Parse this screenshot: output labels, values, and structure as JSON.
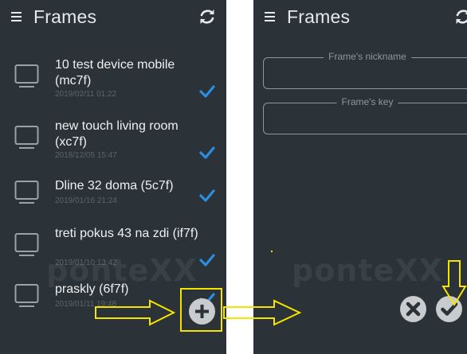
{
  "app": {
    "title": "Frames",
    "icons": {
      "menu": "menu-icon",
      "refresh": "refresh-icon"
    }
  },
  "frames_list": [
    {
      "name": "10 test device mobile (mc7f)",
      "date": "2019/02/11 01:22",
      "checked": true,
      "icon": "tv-icon"
    },
    {
      "name": "new touch living room (xc7f)",
      "date": "2018/12/05 15:47",
      "checked": true,
      "icon": "tv-icon"
    },
    {
      "name": "Dline 32 doma (5c7f)",
      "date": "2019/01/16 21:24",
      "checked": true,
      "icon": "tv-icon"
    },
    {
      "name": "treti pokus 43 na zdi (if7f)",
      "date": "2019/01/10 13:42",
      "checked": true,
      "icon": "tv-icon"
    },
    {
      "name": "praskly (6f7f)",
      "date": "2019/01/11 19:48",
      "checked": true,
      "icon": "tv-icon"
    }
  ],
  "add_frame_form": {
    "nickname_label": "Frame's nickname",
    "nickname_value": "",
    "key_label": "Frame's key",
    "key_value": ""
  },
  "buttons": {
    "add": "plus-icon",
    "cancel": "close-icon",
    "confirm": "check-icon"
  },
  "watermark_text": "ponteXX",
  "colors": {
    "screen_bg": "#2b3238",
    "check_blue": "#2a8fe0",
    "annotation_yellow": "#f4e400",
    "button_grey": "#c9ccce"
  }
}
